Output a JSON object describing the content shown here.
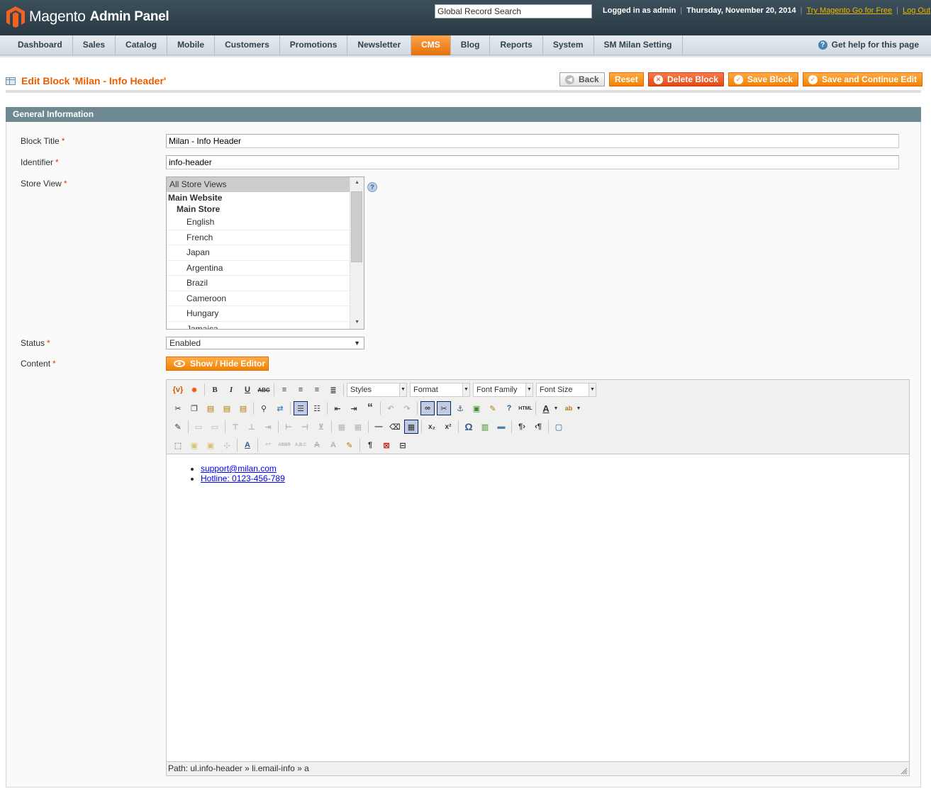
{
  "header": {
    "logo_text": "Magento",
    "logo_suffix": "Admin Panel",
    "search_placeholder": "Global Record Search",
    "logged_in": "Logged in as admin",
    "date": "Thursday, November 20, 2014",
    "try_link": "Try Magento Go for Free",
    "logout": "Log Out"
  },
  "nav": {
    "items": [
      "Dashboard",
      "Sales",
      "Catalog",
      "Mobile",
      "Customers",
      "Promotions",
      "Newsletter",
      "CMS",
      "Blog",
      "Reports",
      "System",
      "SM Milan Setting"
    ],
    "active": "CMS",
    "help": "Get help for this page"
  },
  "page": {
    "title": "Edit Block 'Milan - Info Header'",
    "buttons": {
      "back": "Back",
      "reset": "Reset",
      "delete": "Delete Block",
      "save": "Save Block",
      "save_continue": "Save and Continue Edit"
    }
  },
  "form": {
    "section": "General Information",
    "labels": {
      "block_title": "Block Title",
      "identifier": "Identifier",
      "store_view": "Store View",
      "status": "Status",
      "content": "Content"
    },
    "required_mark": "*",
    "block_title_value": "Milan - Info Header",
    "identifier_value": "info-header",
    "store_views": {
      "all": "All Store Views",
      "website": "Main Website",
      "store": "Main Store",
      "views": [
        "English",
        "French",
        "Japan",
        "Argentina",
        "Brazil",
        "Cameroon",
        "Hungary",
        "Jamaica"
      ]
    },
    "status_value": "Enabled",
    "toggle_editor": "Show / Hide Editor"
  },
  "editor": {
    "dropdowns": {
      "styles": "Styles",
      "format": "Format",
      "font_family": "Font Family",
      "font_size": "Font Size"
    },
    "content": [
      "support@milan.com",
      "Hotline: 0123-456-789"
    ],
    "path": "Path: ul.info-header » li.email-info » a"
  }
}
